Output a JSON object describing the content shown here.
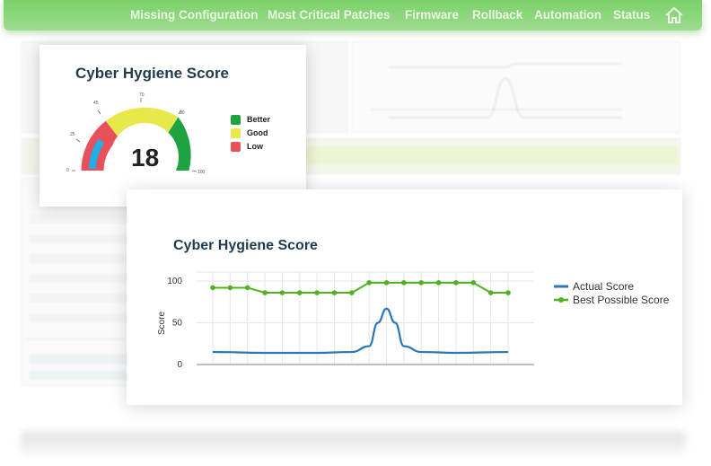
{
  "nav": {
    "items": [
      "Missing Configuration",
      "Most Critical Patches",
      "Firmware",
      "Rollback",
      "Automation",
      "Status"
    ],
    "home_icon": "home-icon",
    "accent": "#8fd67e"
  },
  "gauge_card": {
    "title": "Cyber Hygiene Score",
    "score": "18",
    "score_value": 18,
    "scale_ticks": [
      "0",
      "25",
      "45",
      "70",
      "90",
      "100"
    ],
    "legend": [
      {
        "label": "Better",
        "color": "#1fa240"
      },
      {
        "label": "Good",
        "color": "#e8e84a"
      },
      {
        "label": "Low",
        "color": "#e8505b"
      }
    ],
    "needle_color": "#1eaee8"
  },
  "chart_card": {
    "title": "Cyber Hygiene Score"
  },
  "chart_data": {
    "type": "line",
    "title": "Cyber Hygiene Score",
    "xlabel": "",
    "ylabel": "Score",
    "ylim": [
      0,
      100
    ],
    "yticks": [
      0,
      50,
      100
    ],
    "grid": true,
    "legend_position": "right",
    "series": [
      {
        "name": "Actual Score",
        "color": "#2a78b8",
        "x": [
          0,
          3,
          6,
          8,
          9,
          9.5,
          10,
          10.5,
          11,
          12,
          14,
          17
        ],
        "values": [
          15,
          14,
          14,
          15,
          22,
          50,
          67,
          50,
          22,
          15,
          14,
          15
        ]
      },
      {
        "name": "Best Possible Score",
        "color": "#4fb31f",
        "x": [
          0,
          1,
          2,
          3,
          4,
          5,
          6,
          7,
          8,
          9,
          10,
          11,
          12,
          13,
          14,
          15,
          16,
          17
        ],
        "values": [
          92,
          92,
          92,
          86,
          86,
          86,
          86,
          86,
          86,
          98,
          98,
          98,
          98,
          98,
          98,
          98,
          86,
          86
        ]
      }
    ]
  }
}
